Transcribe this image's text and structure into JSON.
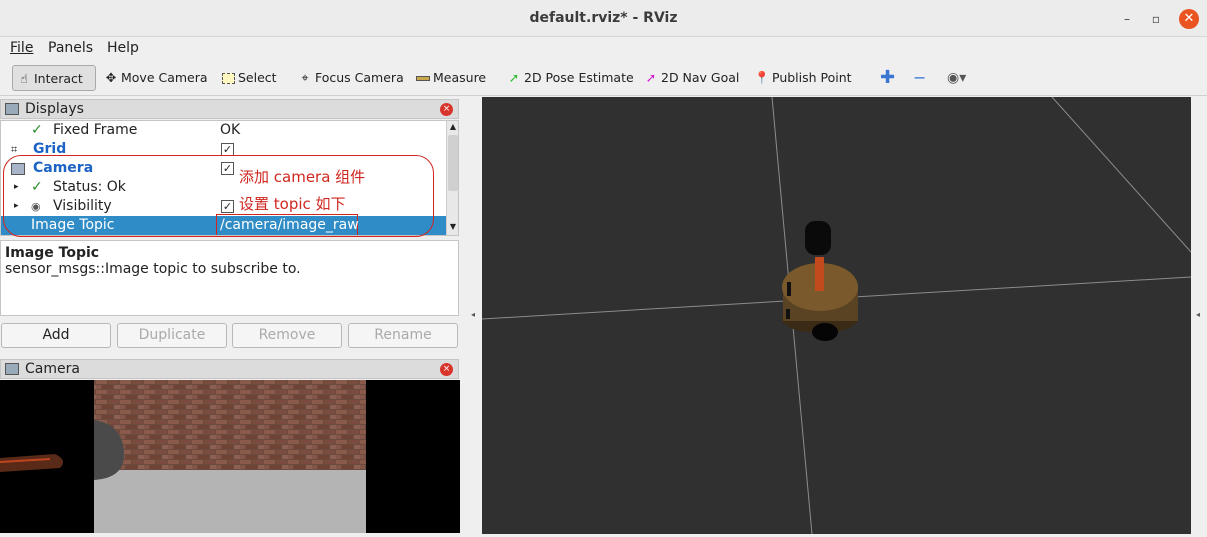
{
  "window": {
    "title": "default.rviz* - RViz",
    "min_icon": "–",
    "max_icon": "▫",
    "close_icon": "✕"
  },
  "menu": [
    {
      "label": "File"
    },
    {
      "label": "Panels"
    },
    {
      "label": "Help"
    }
  ],
  "toolbar": {
    "interact": "Interact",
    "move_camera": "Move Camera",
    "select": "Select",
    "focus_camera": "Focus Camera",
    "measure": "Measure",
    "pose_estimate": "2D Pose Estimate",
    "nav_goal": "2D Nav Goal",
    "publish_point": "Publish Point",
    "colors": {
      "pose_estimate": "#2dbd2d",
      "nav_goal": "#d51dd5",
      "publish_point": "#d9342b",
      "plus": "#3b77d1"
    }
  },
  "displays": {
    "title": "Displays",
    "rows": [
      {
        "label": "Fixed Frame",
        "value": "OK"
      },
      {
        "label": "Grid"
      },
      {
        "label": "Camera"
      },
      {
        "label": "Status: Ok"
      },
      {
        "label": "Visibility"
      },
      {
        "label": "Image Topic",
        "value": "/camera/image_raw"
      }
    ],
    "annotations": {
      "add_camera": "添加 camera 组件",
      "set_topic": "设置 topic 如下"
    },
    "colors": {
      "link": "#1b63c4",
      "selected": "#308cc6",
      "annot": "#d0261f"
    }
  },
  "description": {
    "title": "Image Topic",
    "text": "sensor_msgs::Image topic to subscribe to."
  },
  "buttons": {
    "add": "Add",
    "duplicate": "Duplicate",
    "remove": "Remove",
    "rename": "Rename"
  },
  "camera_panel": {
    "title": "Camera"
  }
}
